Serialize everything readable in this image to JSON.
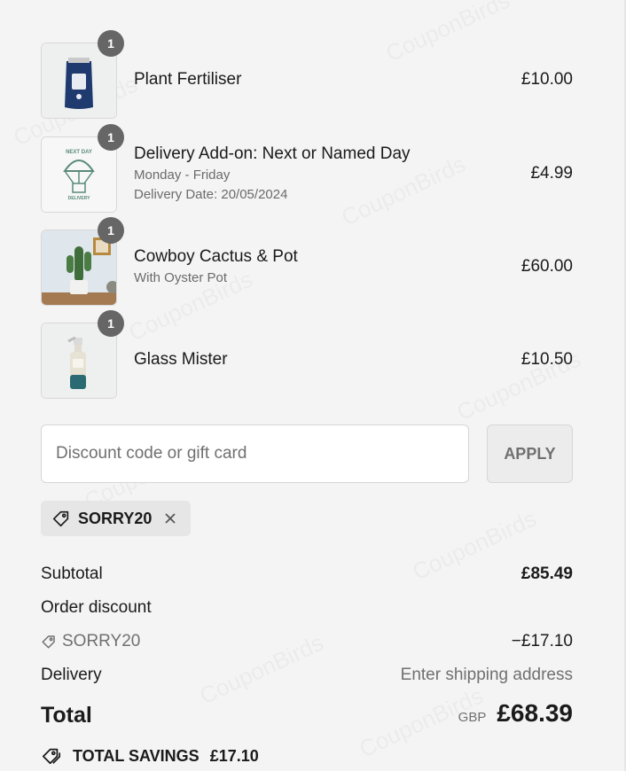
{
  "items": [
    {
      "name": "Plant Fertiliser",
      "sub1": "",
      "sub2": "",
      "price": "£10.00",
      "qty": "1"
    },
    {
      "name": "Delivery Add-on: Next or Named Day",
      "sub1": "Monday - Friday",
      "sub2": "Delivery Date: 20/05/2024",
      "price": "£4.99",
      "qty": "1",
      "badge_top": "NEXT DAY",
      "badge_bottom": "DELIVERY"
    },
    {
      "name": "Cowboy Cactus & Pot",
      "sub1": "With Oyster Pot",
      "sub2": "",
      "price": "£60.00",
      "qty": "1"
    },
    {
      "name": "Glass Mister",
      "sub1": "",
      "sub2": "",
      "price": "£10.50",
      "qty": "1"
    }
  ],
  "discount": {
    "placeholder": "Discount code or gift card",
    "apply_label": "APPLY",
    "applied_code": "SORRY20"
  },
  "summary": {
    "subtotal_label": "Subtotal",
    "subtotal_value": "£85.49",
    "order_discount_label": "Order discount",
    "discount_code": "SORRY20",
    "discount_value": "−£17.10",
    "delivery_label": "Delivery",
    "delivery_value": "Enter shipping address",
    "total_label": "Total",
    "currency": "GBP",
    "total_value": "£68.39",
    "savings_label": "TOTAL SAVINGS",
    "savings_value": "£17.10"
  },
  "watermark_text": "CouponBirds",
  "colors": {
    "background": "#f4f4f4",
    "badge": "#666666",
    "chip": "#e6e6e6"
  }
}
